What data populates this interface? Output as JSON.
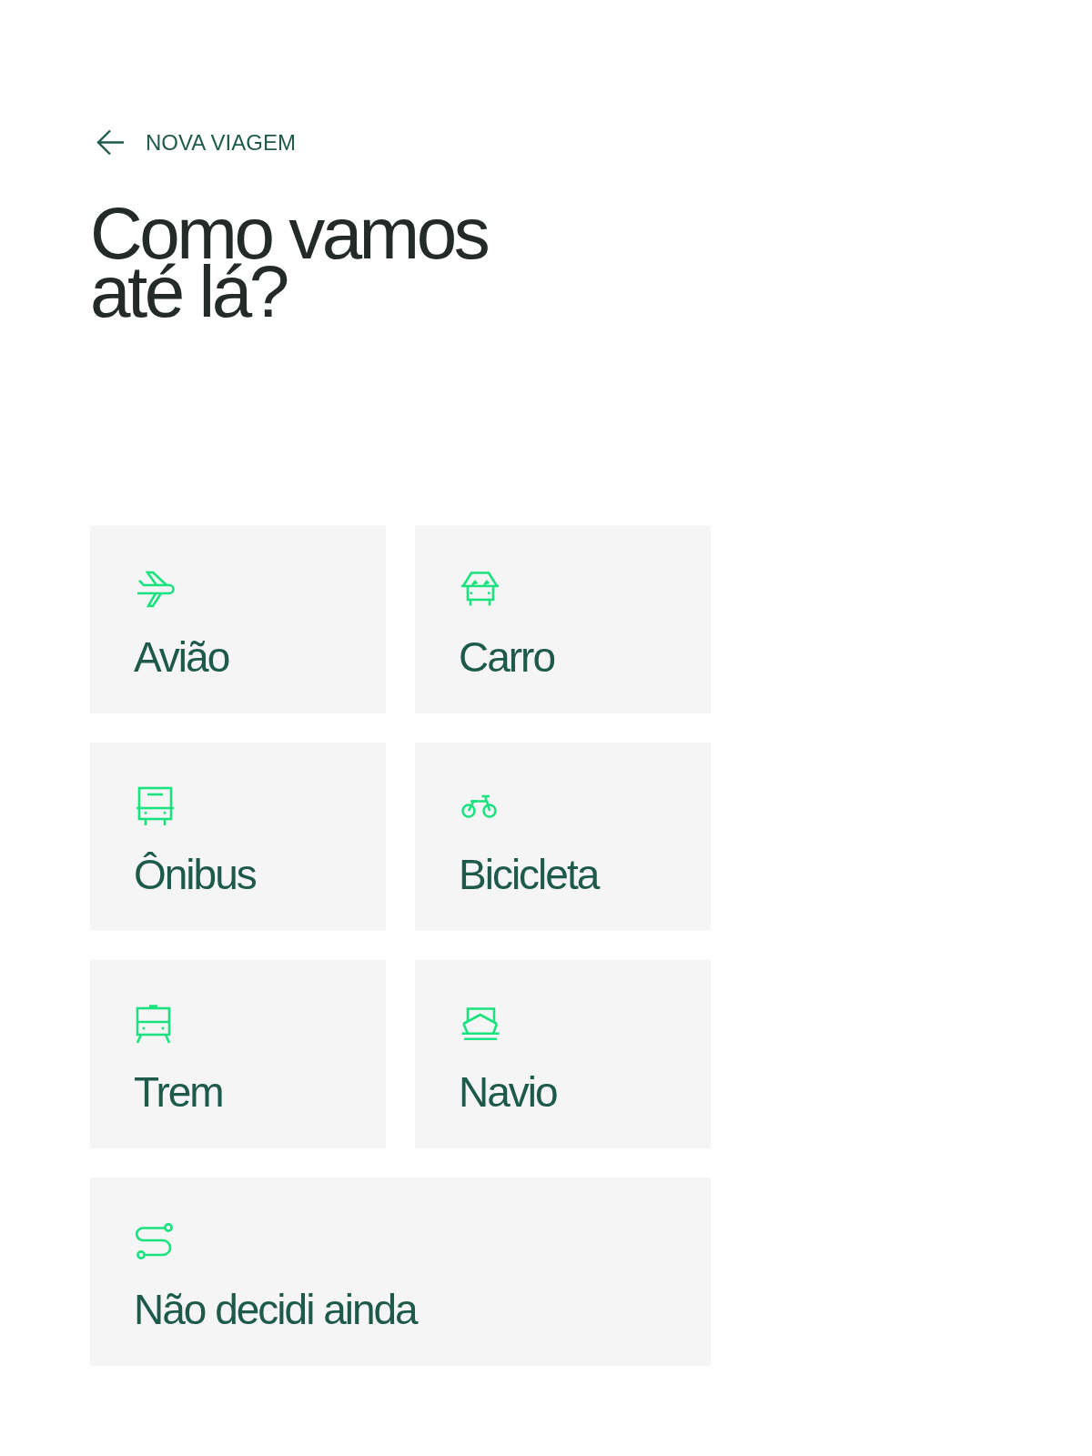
{
  "header": {
    "back_label": "NOVA VIAGEM"
  },
  "title": "Como vamos até lá?",
  "options": [
    {
      "kind": "plane",
      "label": "Avião",
      "selected": false
    },
    {
      "kind": "car",
      "label": "Carro",
      "selected": false
    },
    {
      "kind": "bus",
      "label": "Ônibus",
      "selected": false
    },
    {
      "kind": "bicycle",
      "label": "Bicicleta",
      "selected": false
    },
    {
      "kind": "train",
      "label": "Trem",
      "selected": false
    },
    {
      "kind": "ship",
      "label": "Navio",
      "selected": false
    },
    {
      "kind": "route",
      "label": "Não decidi ainda",
      "selected": false
    }
  ]
}
